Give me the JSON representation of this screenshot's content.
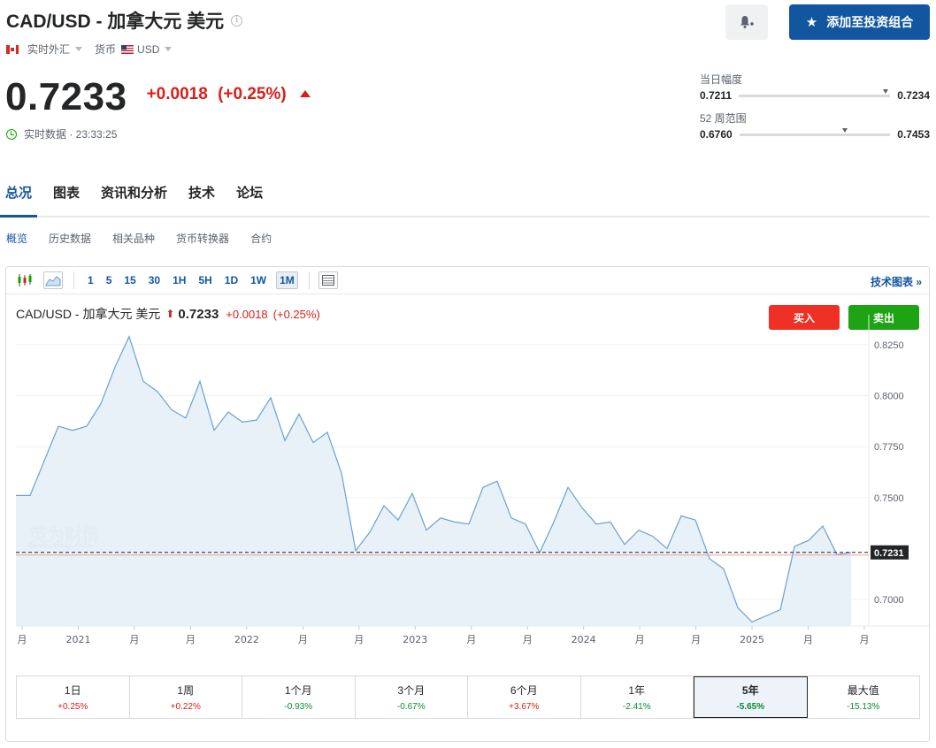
{
  "header": {
    "title": "CAD/USD - 加拿大元 美元",
    "market": "实时外汇",
    "currency_label": "货币",
    "currency": "USD",
    "add_button": "添加至投资组合",
    "price": "0.7233",
    "change": "+0.0018",
    "change_pct": "(+0.25%)",
    "live_text": "实时数据 · 23:33:25"
  },
  "ranges": {
    "day": {
      "label": "当日幅度",
      "low": "0.7211",
      "high": "0.7234",
      "position": 0.95
    },
    "week52": {
      "label": "52 周范围",
      "low": "0.6760",
      "high": "0.7453",
      "position": 0.68
    }
  },
  "tabs": [
    "总况",
    "图表",
    "资讯和分析",
    "技术",
    "论坛"
  ],
  "sub_tabs": [
    "概览",
    "历史数据",
    "相关品种",
    "货币转换器",
    "合约"
  ],
  "toolbar": {
    "periods": [
      "1",
      "5",
      "15",
      "30",
      "1H",
      "5H",
      "1D",
      "1W",
      "1M"
    ],
    "active_period": "1M",
    "tech_link": "技术图表 »"
  },
  "chart_head": {
    "name": "CAD/USD - 加拿大元 美元",
    "price": "0.7233",
    "change": "+0.0018",
    "change_pct": "(+0.25%)",
    "buy": "买入",
    "sell": "卖出"
  },
  "watermark": {
    "cn": "英为财情",
    "en": "Investing.com"
  },
  "chart_data": {
    "type": "area",
    "y_ticks": [
      "0.8250",
      "0.8000",
      "0.7750",
      "0.7500",
      "0.7000"
    ],
    "ylim": [
      0.687,
      0.831
    ],
    "current_label": "0.7231",
    "current_value": 0.7231,
    "x_labels": [
      "月",
      "2021",
      "月",
      "月",
      "2022",
      "月",
      "月",
      "2023",
      "月",
      "月",
      "2024",
      "月",
      "月",
      "2025",
      "月",
      "月"
    ],
    "values": [
      0.751,
      0.751,
      0.768,
      0.785,
      0.783,
      0.785,
      0.796,
      0.814,
      0.829,
      0.807,
      0.802,
      0.793,
      0.789,
      0.807,
      0.783,
      0.792,
      0.787,
      0.788,
      0.799,
      0.778,
      0.791,
      0.777,
      0.782,
      0.762,
      0.724,
      0.733,
      0.746,
      0.739,
      0.752,
      0.734,
      0.74,
      0.738,
      0.737,
      0.755,
      0.758,
      0.74,
      0.737,
      0.723,
      0.738,
      0.755,
      0.745,
      0.737,
      0.738,
      0.727,
      0.734,
      0.731,
      0.725,
      0.741,
      0.739,
      0.72,
      0.715,
      0.696,
      0.689,
      0.692,
      0.695,
      0.726,
      0.729,
      0.736,
      0.722,
      0.7231
    ]
  },
  "performance": [
    {
      "label": "1日",
      "value": "+0.25%",
      "dir": "pos"
    },
    {
      "label": "1周",
      "value": "+0.22%",
      "dir": "pos"
    },
    {
      "label": "1个月",
      "value": "-0.93%",
      "dir": "neg"
    },
    {
      "label": "3个月",
      "value": "-0.67%",
      "dir": "neg"
    },
    {
      "label": "6个月",
      "value": "+3.67%",
      "dir": "pos"
    },
    {
      "label": "1年",
      "value": "-2.41%",
      "dir": "neg"
    },
    {
      "label": "5年",
      "value": "-5.65%",
      "dir": "neg",
      "active": true
    },
    {
      "label": "最大值",
      "value": "-15.13%",
      "dir": "neg"
    }
  ],
  "colors": {
    "accent": "#1256a0",
    "up": "#d91e18",
    "down": "#0a8a33",
    "line": "#6aa1d0",
    "fill": "#e6eef7"
  }
}
